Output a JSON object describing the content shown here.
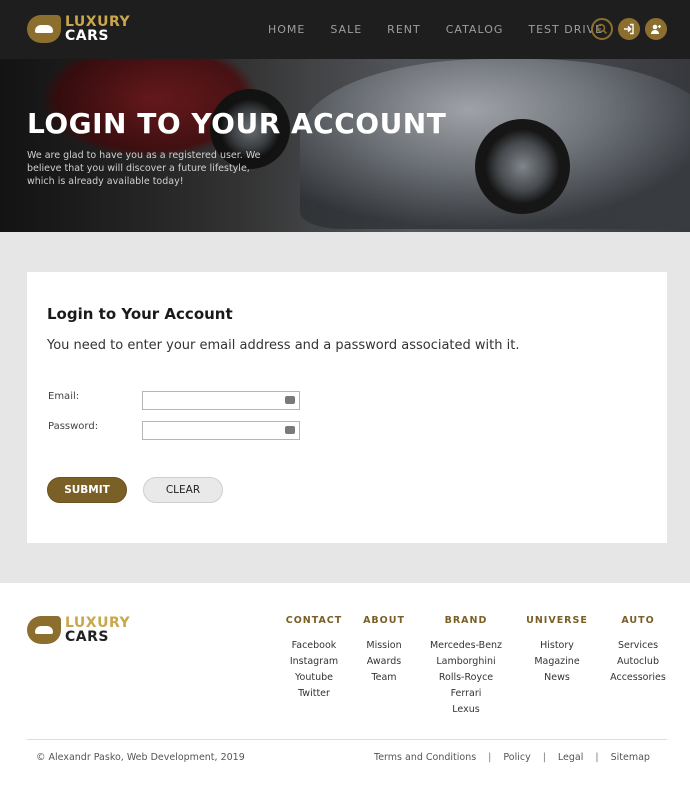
{
  "header": {
    "logo": {
      "top": "LUXURY",
      "bottom": "CARS"
    },
    "nav": [
      "HOME",
      "SALE",
      "RENT",
      "CATALOG",
      "TEST DRIVE"
    ],
    "icons": [
      "search-icon",
      "login-icon",
      "add-user-icon"
    ]
  },
  "hero": {
    "title": "LOGIN TO YOUR ACCOUNT",
    "subtitle": "We are glad to have you as a registered user. We believe that you will discover a future lifestyle, which is already available today!"
  },
  "login": {
    "title": "Login to Your Account",
    "description": "You need to enter your email address and a password associated with it.",
    "email_label": "Email:",
    "email_value": "",
    "password_label": "Password:",
    "password_value": "",
    "submit_label": "SUBMIT",
    "clear_label": "CLEAR"
  },
  "footer": {
    "logo": {
      "top": "LUXURY",
      "bottom": "CARS"
    },
    "columns": [
      {
        "heading": "CONTACT",
        "items": [
          "Facebook",
          "Instagram",
          "Youtube",
          "Twitter"
        ]
      },
      {
        "heading": "ABOUT",
        "items": [
          "Mission",
          "Awards",
          "Team"
        ]
      },
      {
        "heading": "BRAND",
        "items": [
          "Mercedes-Benz",
          "Lamborghini",
          "Rolls-Royce",
          "Ferrari",
          "Lexus"
        ]
      },
      {
        "heading": "UNIVERSE",
        "items": [
          "History",
          "Magazine",
          "News"
        ]
      },
      {
        "heading": "AUTO",
        "items": [
          "Services",
          "Autoclub",
          "Accessories"
        ]
      }
    ],
    "copyright": "© Alexandr Pasko, Web Development, 2019",
    "links": [
      "Terms and Conditions",
      "Policy",
      "Legal",
      "Sitemap"
    ],
    "separator": "|"
  },
  "colors": {
    "accent": "#8c6f2e",
    "header_bg": "#1e1e1e",
    "page_bg": "#e6e6e6"
  }
}
